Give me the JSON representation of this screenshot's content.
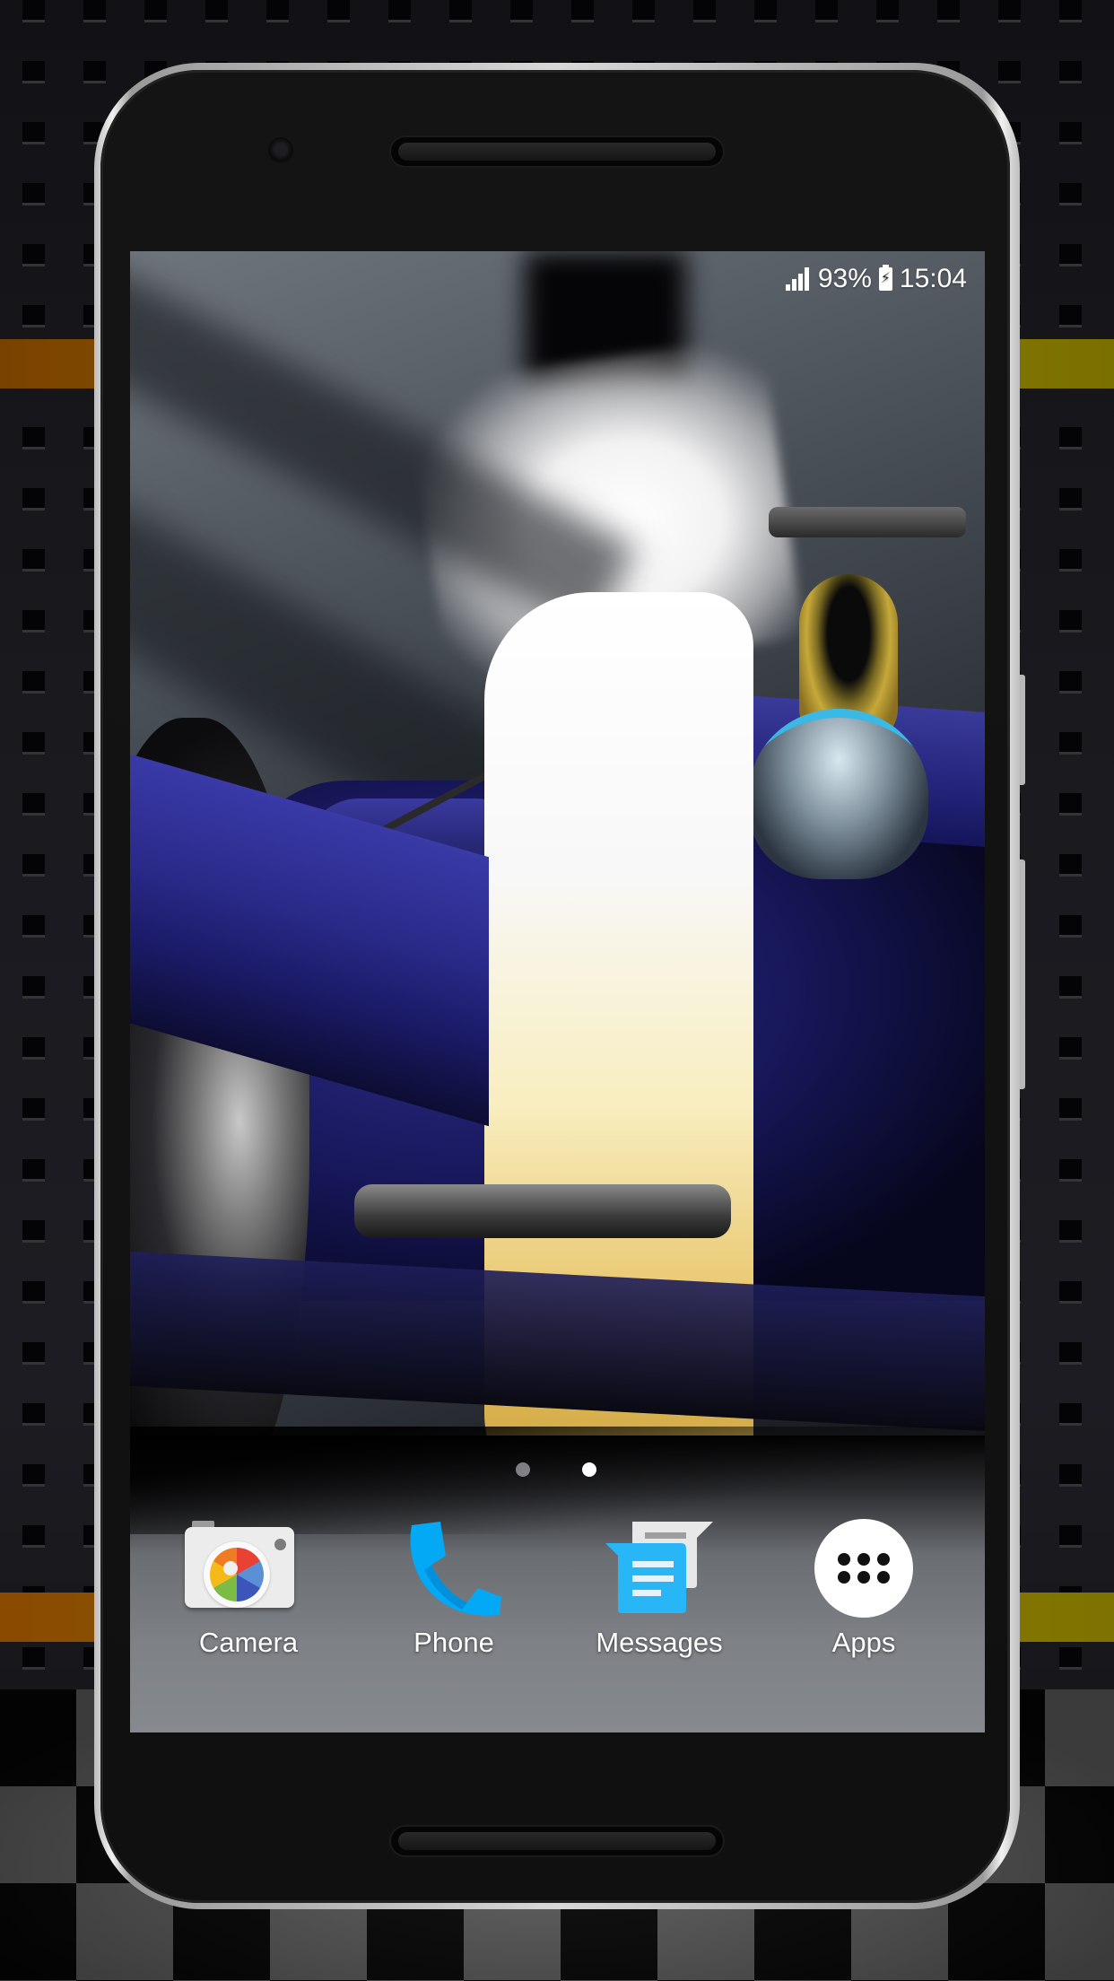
{
  "status_bar": {
    "signal_icon": "signal-bars-icon",
    "battery_percent": "93%",
    "battery_icon": "battery-charging-icon",
    "battery_glyph": "⚡",
    "time": "15:04"
  },
  "home": {
    "wallpaper": "Formula 1 race car (blue and yellow) live wallpaper",
    "pages": {
      "count": 2,
      "current": 2
    }
  },
  "dock": {
    "items": [
      {
        "label": "Camera",
        "icon": "camera-icon"
      },
      {
        "label": "Phone",
        "icon": "phone-icon",
        "color": "#03a9f4"
      },
      {
        "label": "Messages",
        "icon": "messages-icon",
        "color": "#29b6f6"
      },
      {
        "label": "Apps",
        "icon": "app-drawer-icon"
      }
    ]
  },
  "colors": {
    "stripe_left": "#8a4a00",
    "stripe_right": "#8a7a00",
    "phone_body": "#111111",
    "phone_frame": "#d8d8d8"
  }
}
